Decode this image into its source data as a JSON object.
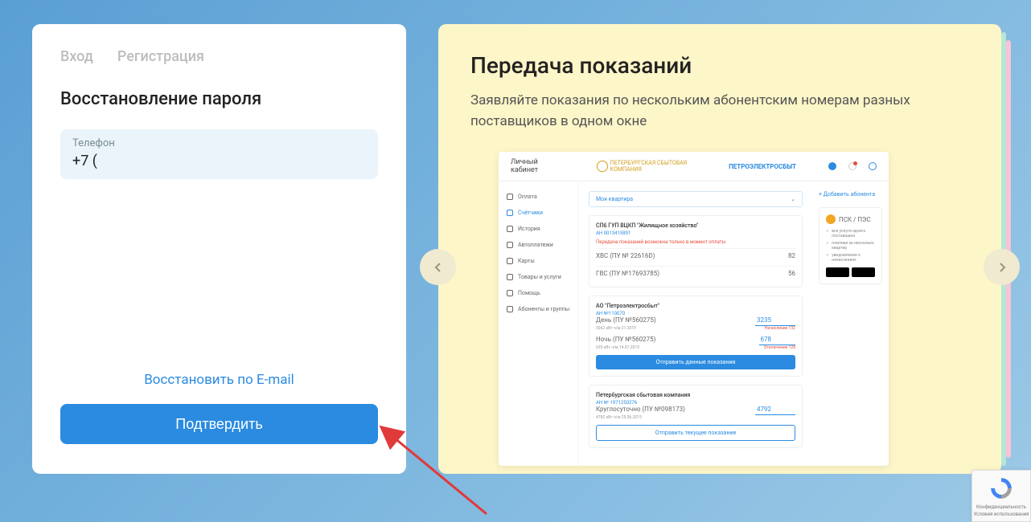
{
  "login": {
    "tab_login": "Вход",
    "tab_register": "Регистрация",
    "heading": "Восстановление пароля",
    "phone_label": "Телефон",
    "phone_value": "+7 (",
    "restore_email": "Восстановить по E-mail",
    "confirm": "Подтвердить"
  },
  "promo": {
    "title": "Передача показаний",
    "description": "Заявляйте показания по нескольким абонентским номерам разных поставщиков в одном окне"
  },
  "mock": {
    "header_title": "Личный кабинет",
    "logo1": "ПЕТЕРБУРГСКАЯ СБЫТОВАЯ КОМПАНИЯ",
    "logo2": "ПЕТРОЭЛЕКТРОСБЫТ",
    "sidebar": {
      "oplata": "Оплата",
      "schetchiki": "Счётчики",
      "istoriya": "История",
      "avtoplatezhi": "Автоплатежи",
      "karty": "Карты",
      "tovary": "Товары и услуги",
      "pomosh": "Помощь",
      "abonenty": "Абоненты и группы"
    },
    "select": "Моя квартира",
    "add_subscriber": "+ Добавить абонента",
    "block1": {
      "title": "СПб ГУП ВЦКП \"Жилищное хозяйство\"",
      "sub": "АН 0013415891",
      "warning": "Передача показаний возможна только в момент оплаты",
      "row1_label": "ХВС (ПУ № 22616D)",
      "row1_sub": "82",
      "row2_label": "ГВС (ПУ №17693785)",
      "row2_sub": "56"
    },
    "block2": {
      "title": "АО \"Петроэлектросбыт\"",
      "sub": "АН №110070",
      "day_label": "День (ПУ №560275)",
      "day_sub": "3062 кВт ч/м 21.2019",
      "day_val": "3235",
      "day_note": "Начисление 132",
      "night_label": "Ночь (ПУ №560275)",
      "night_sub": "655 кВт ч/м 14.07.2019",
      "night_val": "678",
      "night_note": "Отключение 128",
      "btn": "Отправить данные показания"
    },
    "block3": {
      "title": "Петербургская сбытовая компания",
      "sub": "АН № 1971250276",
      "row_label": "Круглосуточно (ПУ №098173)",
      "row_sub": "4782 кВт ч/м 25.06.2019",
      "row_val": "4792",
      "btn": "Отправить текущее показание"
    },
    "provider": {
      "name": "ПСК / ПЭС",
      "check1": "все услуги одного поставщика",
      "check2": "платежи за несколько квартир",
      "check3": "уведомления о начислениях"
    }
  },
  "recaptcha": {
    "line1": "Конфиденциальность",
    "line2": "Условия использования"
  }
}
